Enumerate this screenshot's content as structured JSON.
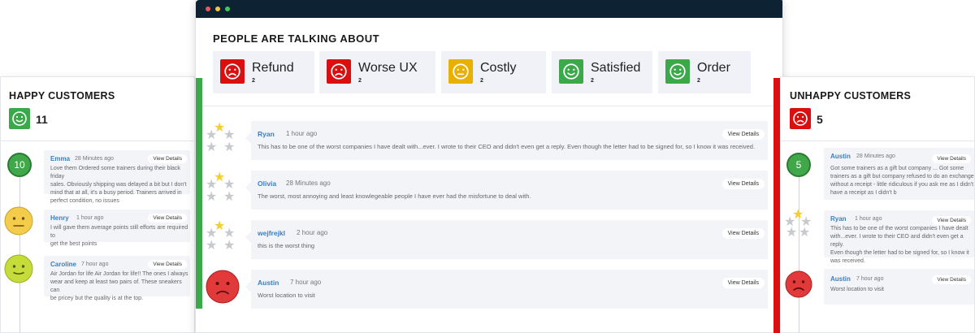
{
  "colors": {
    "happy": "#3ba94a",
    "unhappy": "#d90f10",
    "neutral": "#e8b000",
    "link": "#3b7ec2",
    "titlebar": "#0d2233"
  },
  "left_panel": {
    "title": "HAPPY CUSTOMERS",
    "count": "11",
    "icon": "smile-icon",
    "items": [
      {
        "badge": "10",
        "name": "Emma",
        "time": "28 Minutes ago",
        "action": "View Details",
        "text": [
          "Love them Ordered some trainers during their black friday",
          "sales. Obviously shipping was delayed a bit but I don't",
          "mind that at all, it's a busy period. Trainers arrived in",
          "perfect condition, no issues"
        ]
      },
      {
        "badge_icon": "neutral-face-icon",
        "name": "Henry",
        "time": "1 hour ago",
        "action": "View Details",
        "text": [
          "I will gave them average points still efforts are required to",
          "get the best points"
        ]
      },
      {
        "badge_icon": "slight-smile-face-icon",
        "name": "Caroline",
        "time": "7 hour ago",
        "action": "View Details",
        "text": [
          "Air Jordan for life Air Jordan for life!! The ones I always",
          "wear and keep at least two pairs of. These sneakers can",
          "be pricey but the quality is at the top."
        ]
      }
    ]
  },
  "main": {
    "heading": "PEOPLE ARE TALKING ABOUT",
    "topics": [
      {
        "label": "Refund",
        "count": "2",
        "mood": "sad"
      },
      {
        "label": "Worse UX",
        "count": "2",
        "mood": "sad"
      },
      {
        "label": "Costly",
        "count": "2",
        "mood": "neutral"
      },
      {
        "label": "Satisfied",
        "count": "2",
        "mood": "happy"
      },
      {
        "label": "Order",
        "count": "2",
        "mood": "happy"
      }
    ],
    "reviews": [
      {
        "name": "Ryan",
        "time": "1 hour ago",
        "rating": 1,
        "action": "View Details",
        "text": "This has to be one of the worst companies I have dealt with...ever. I wrote to their CEO and didn't even get a reply. Even though the letter had to be signed for, so I know it was received."
      },
      {
        "name": "Olivia",
        "time": "28 Minutes ago",
        "rating": 1,
        "action": "View Details",
        "text": "The worst, most annoying and least knowlegeable people I have ever had the misfortune to deal with."
      },
      {
        "name": "wejfrejkl",
        "time": "2 hour ago",
        "rating": 1,
        "action": "View Details",
        "text": "this is the worst thing"
      },
      {
        "name": "Austin",
        "time": "7 hour ago",
        "badge_icon": "sad-face-icon",
        "action": "View Details",
        "text": "Worst location to visit"
      }
    ]
  },
  "right_panel": {
    "title": "UNHAPPY CUSTOMERS",
    "count": "5",
    "icon": "sad-icon",
    "items": [
      {
        "badge": "5",
        "name": "Austin",
        "time": "28 Minutes ago",
        "action": "View Details",
        "text": [
          "Got some trainers as a gift but company ... Got some",
          "trainers as a gift but company refused to do an exchange",
          "without a receipt - little ridiculous if you ask me as I didn't",
          "have a receipt as I didn't b"
        ]
      },
      {
        "rating": 1,
        "name": "Ryan",
        "time": "1 hour ago",
        "action": "View Details",
        "text": [
          "This has to be one of the worst companies I have dealt",
          "with...ever. I wrote to their CEO and didn't even get a reply.",
          "Even though the letter had to be signed for, so I know it",
          "was received."
        ]
      },
      {
        "badge_icon": "sad-face-icon",
        "name": "Austin",
        "time": "7 hour ago",
        "action": "View Details",
        "text": [
          "Worst location to visit"
        ]
      }
    ]
  }
}
